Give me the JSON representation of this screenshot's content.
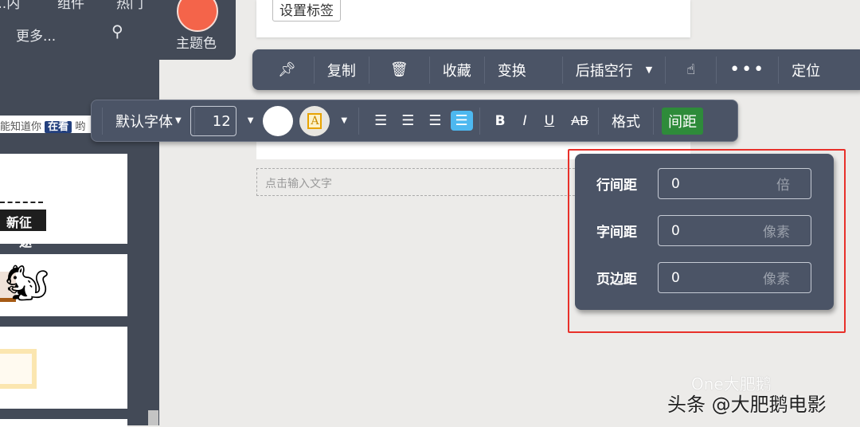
{
  "nav": {
    "row1": [
      "...内",
      "组件",
      "热门"
    ],
    "more": "更多...",
    "theme_label": "主题色"
  },
  "sidebar": {
    "hint_pre": "能知道你",
    "hint_tag": "在看",
    "hint_post": "哟",
    "card1_text": "新征途"
  },
  "main": {
    "set_tag": "设置标签",
    "placeholder": "点击输入文字"
  },
  "toolbar1": {
    "copy": "复制",
    "collect": "收藏",
    "transform": "变换",
    "insert_after": "后插空行",
    "locate": "定位"
  },
  "toolbar2": {
    "font": "默认字体",
    "size": "12",
    "bold": "B",
    "italic": "I",
    "underline": "U",
    "strike": "AB",
    "format": "格式",
    "spacing": "间距"
  },
  "spacing_panel": {
    "rows": [
      {
        "label": "行间距",
        "value": "0",
        "unit": "倍"
      },
      {
        "label": "字间距",
        "value": "0",
        "unit": "像素"
      },
      {
        "label": "页边距",
        "value": "0",
        "unit": "像素"
      }
    ]
  },
  "watermark": {
    "main": "头条 @大肥鹅电影",
    "sub": "One大肥鹅"
  },
  "colors": {
    "theme": "#f4644a",
    "toolbar": "#4b5466",
    "spacing_active": "#2e8b3a",
    "align_active": "#4db8f0",
    "highlight": "#e8302a"
  }
}
